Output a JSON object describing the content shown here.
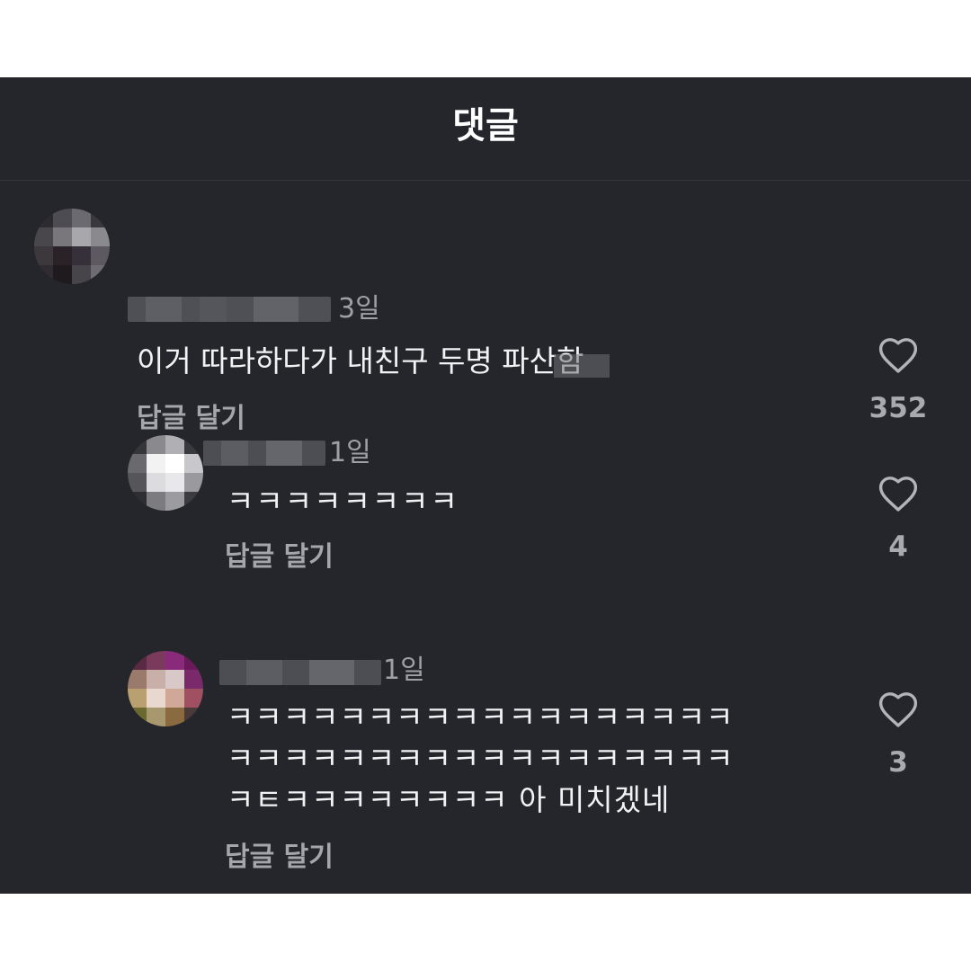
{
  "header": {
    "title": "댓글"
  },
  "comments": [
    {
      "time": "3일",
      "text": "이거 따라하다가 내친구 두명 파산함",
      "reply_label": "답글 달기",
      "like_count": "352",
      "heart_icon": "heart-outline-icon"
    },
    {
      "time": "1일",
      "text": "ㅋㅋㅋㅋㅋㅋㅋㅋ",
      "reply_label": "답글 달기",
      "like_count": "4",
      "heart_icon": "heart-outline-icon"
    },
    {
      "time": "1일",
      "text_line1": "ㅋㅋㅋㅋㅋㅋㅋㅋㅋㅋㅋㅋㅋㅋㅋㅋㅋㅋ",
      "text_line2": "ㅋㅋㅋㅋㅋㅋㅋㅋㅋㅋㅋㅋㅋㅋㅋㅋㅋㅋ",
      "text_line3": "ㅋㅌㅋㅋㅋㅋㅋㅋㅋㅋ 아 미치겠네",
      "reply_label": "답글 달기",
      "like_count": "3",
      "heart_icon": "heart-outline-icon"
    }
  ],
  "colors": {
    "background": "#24262b",
    "text": "#f2f2f4",
    "muted": "#9ea0a6"
  }
}
